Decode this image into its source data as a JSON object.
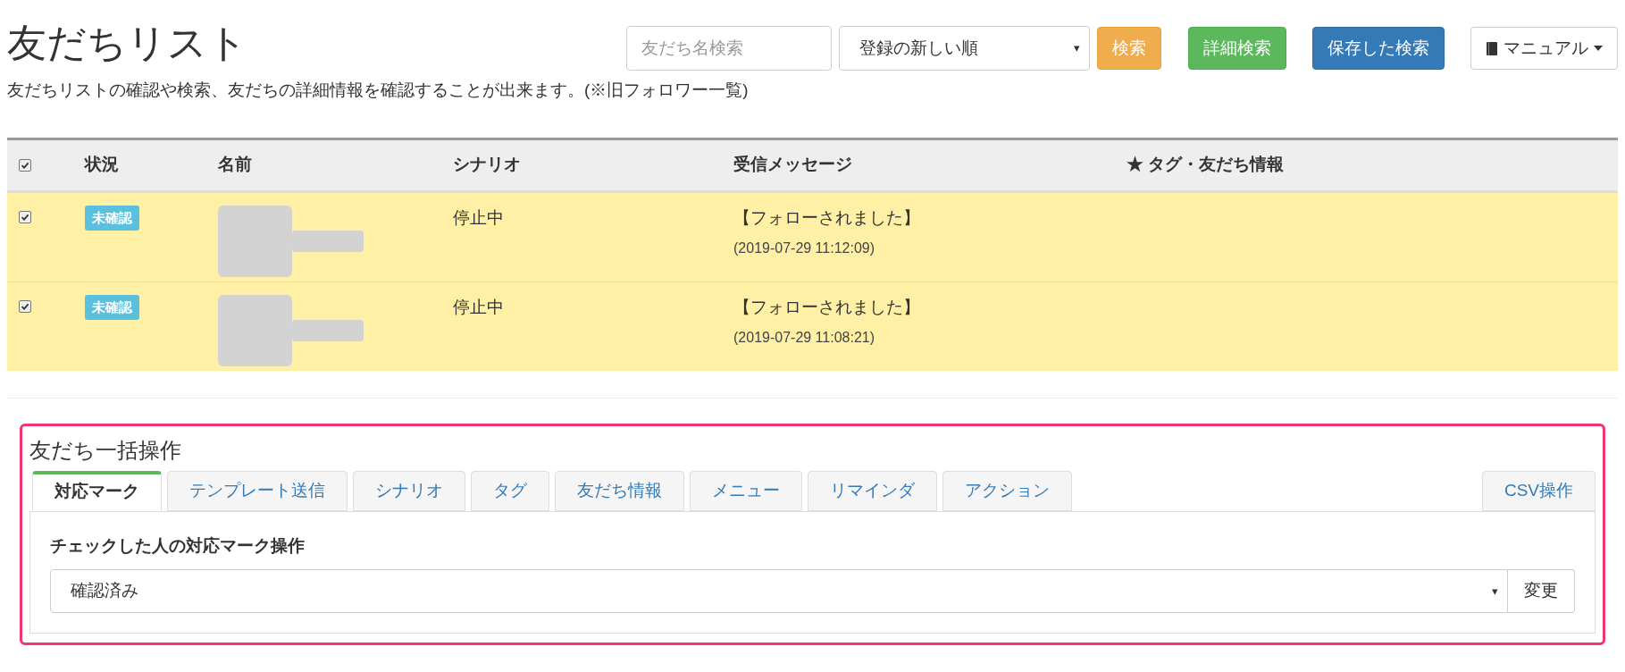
{
  "page": {
    "title": "友だちリスト",
    "description": "友だちリストの確認や検索、友だちの詳細情報を確認することが出来ます。(※旧フォロワー一覧)"
  },
  "toolbar": {
    "search": {
      "placeholder": "友だち名検索"
    },
    "sort": {
      "value": "登録の新しい順",
      "caret": "▾"
    },
    "buttons": [
      {
        "label": "検索",
        "kind": "warning"
      },
      {
        "label": "詳細検索",
        "kind": "success"
      },
      {
        "label": "保存した検索",
        "kind": "primary"
      },
      {
        "label": "マニュアル",
        "kind": "dropdown"
      }
    ]
  },
  "table": {
    "select_all": {
      "checked": true
    },
    "columns": [
      "状況",
      "名前",
      "シナリオ",
      "受信メッセージ",
      "★ タグ・友だち情報"
    ],
    "rows": [
      {
        "checked": true,
        "status": "未確認",
        "scenario": "停止中",
        "message": "【フォローされました】",
        "time": "(2019-07-29 11:12:09)"
      },
      {
        "checked": true,
        "status": "未確認",
        "scenario": "停止中",
        "message": "【フォローされました】",
        "time": "(2019-07-29 11:08:21)"
      }
    ]
  },
  "bulk": {
    "title": "友だち一括操作",
    "tabs": [
      {
        "label": "対応マーク",
        "selected": true
      },
      {
        "label": "テンプレート送信",
        "selected": false
      },
      {
        "label": "シナリオ",
        "selected": false
      },
      {
        "label": "タグ",
        "selected": false
      },
      {
        "label": "友だち情報",
        "selected": false
      },
      {
        "label": "メニュー",
        "selected": false
      },
      {
        "label": "リマインダ",
        "selected": false
      },
      {
        "label": "アクション",
        "selected": false
      }
    ],
    "right_tab": {
      "label": "CSV操作",
      "selected": false
    },
    "section_label": "チェックした人の対応マーク操作",
    "select": {
      "value": "確認済み",
      "caret": "▾"
    },
    "apply_button": "変更"
  }
}
